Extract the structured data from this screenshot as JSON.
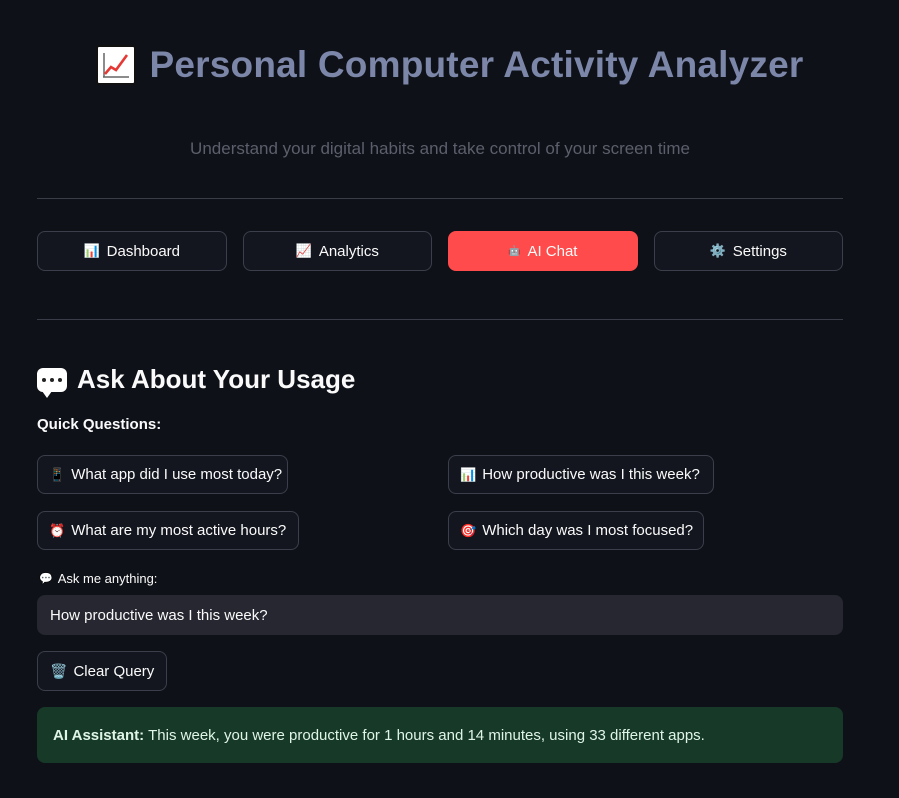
{
  "header": {
    "title": "Personal Computer Activity Analyzer",
    "title_icon": "chart-increasing-icon",
    "subtitle": "Understand your digital habits and take control of your screen time"
  },
  "nav": {
    "tabs": [
      {
        "icon": "📊",
        "icon_name": "bar-chart-icon",
        "label": "Dashboard",
        "active": false
      },
      {
        "icon": "📈",
        "icon_name": "chart-increasing-icon",
        "label": "Analytics",
        "active": false
      },
      {
        "icon": "🤖",
        "icon_name": "robot-icon",
        "label": "AI Chat",
        "active": true
      },
      {
        "icon": "⚙️",
        "icon_name": "gear-icon",
        "label": "Settings",
        "active": false
      }
    ],
    "active_color": "#ff4b4b"
  },
  "chat": {
    "section_title": "Ask About Your Usage",
    "quick_label": "Quick Questions:",
    "quick_questions": [
      {
        "icon": "📱",
        "icon_name": "mobile-phone-icon",
        "label": "What app did I use most today?"
      },
      {
        "icon": "📊",
        "icon_name": "bar-chart-icon",
        "label": "How productive was I this week?"
      },
      {
        "icon": "⏰",
        "icon_name": "alarm-clock-icon",
        "label": "What are my most active hours?"
      },
      {
        "icon": "🎯",
        "icon_name": "target-icon",
        "label": "Which day was I most focused?"
      }
    ],
    "ask_label": "Ask me anything:",
    "query_value": "How productive was I this week?",
    "clear_label": "Clear Query",
    "clear_icon": "🗑️",
    "answer_prefix": "AI Assistant:",
    "answer_text": "This week, you were productive for 1 hours and 14 minutes, using 33 different apps."
  }
}
